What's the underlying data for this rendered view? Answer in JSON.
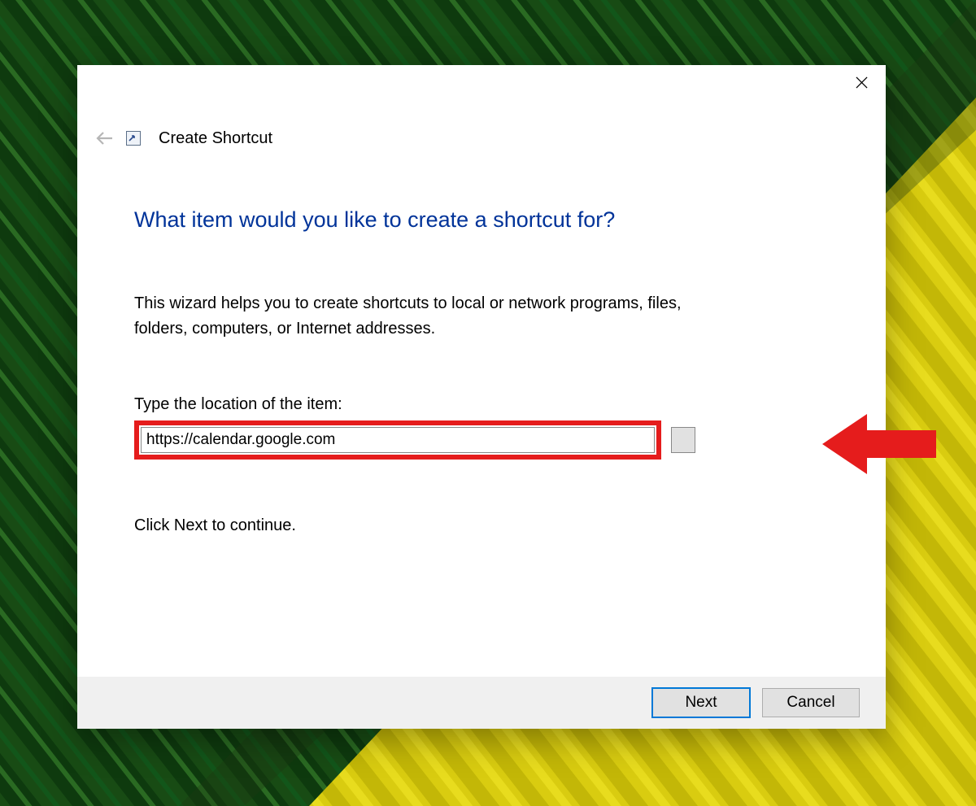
{
  "dialog": {
    "title": "Create Shortcut",
    "headline": "What item would you like to create a shortcut for?",
    "description": "This wizard helps you to create shortcuts to local or network programs, files, folders, computers, or Internet addresses.",
    "field_label": "Type the location of the item:",
    "location_value": "https://calendar.google.com",
    "browse_label": "",
    "continue_text": "Click Next to continue.",
    "buttons": {
      "next": "Next",
      "cancel": "Cancel"
    }
  }
}
